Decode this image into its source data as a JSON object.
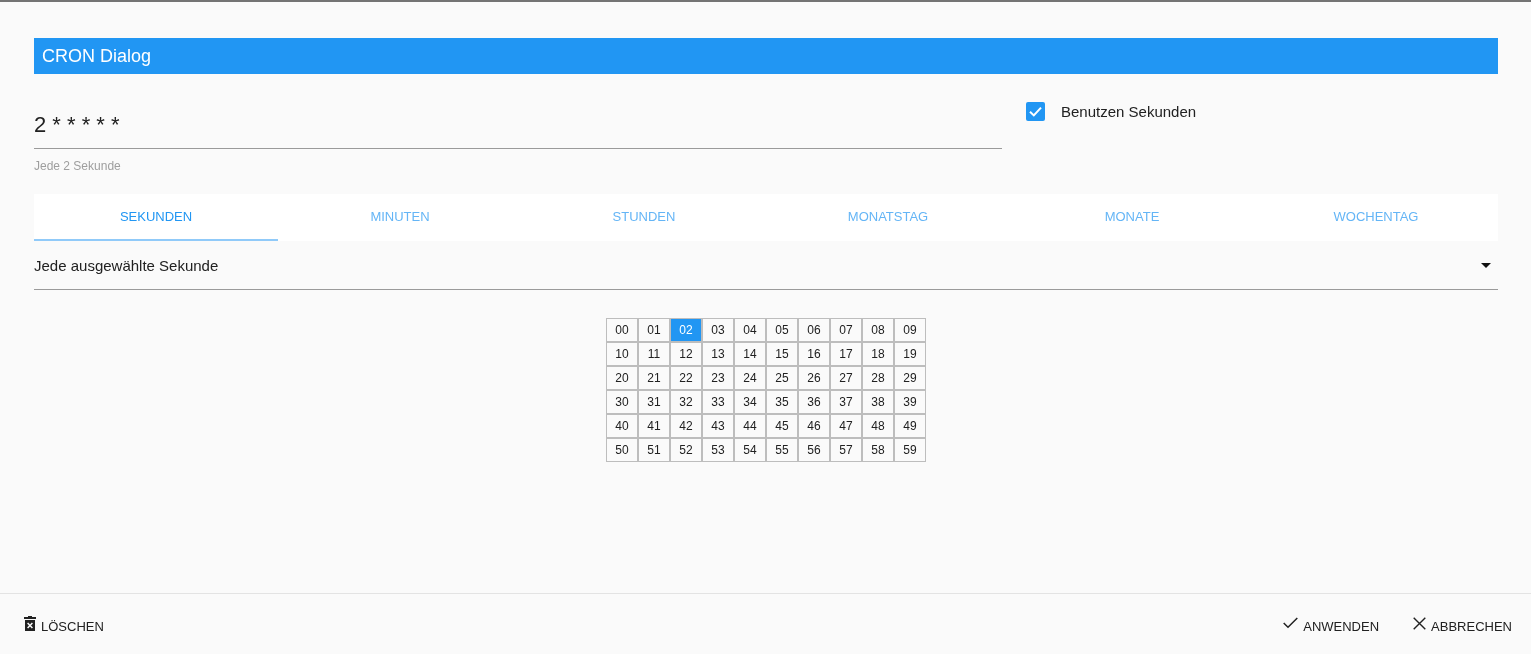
{
  "dialog": {
    "title": "CRON Dialog"
  },
  "cron_field": {
    "value": "2 * * * * *",
    "helper": "Jede 2 Sekunde"
  },
  "use_seconds": {
    "label": "Benutzen Sekunden",
    "checked": true
  },
  "tabs": [
    {
      "label": "SEKUNDEN",
      "selected": true
    },
    {
      "label": "MINUTEN",
      "selected": false
    },
    {
      "label": "STUNDEN",
      "selected": false
    },
    {
      "label": "MONATSTAG",
      "selected": false
    },
    {
      "label": "MONATE",
      "selected": false
    },
    {
      "label": "WOCHENTAG",
      "selected": false
    }
  ],
  "mode_select": {
    "value": "Jede ausgewählte Sekunde"
  },
  "seconds": [
    {
      "label": "00",
      "selected": false
    },
    {
      "label": "01",
      "selected": false
    },
    {
      "label": "02",
      "selected": true
    },
    {
      "label": "03",
      "selected": false
    },
    {
      "label": "04",
      "selected": false
    },
    {
      "label": "05",
      "selected": false
    },
    {
      "label": "06",
      "selected": false
    },
    {
      "label": "07",
      "selected": false
    },
    {
      "label": "08",
      "selected": false
    },
    {
      "label": "09",
      "selected": false
    },
    {
      "label": "10",
      "selected": false
    },
    {
      "label": "11",
      "selected": false
    },
    {
      "label": "12",
      "selected": false
    },
    {
      "label": "13",
      "selected": false
    },
    {
      "label": "14",
      "selected": false
    },
    {
      "label": "15",
      "selected": false
    },
    {
      "label": "16",
      "selected": false
    },
    {
      "label": "17",
      "selected": false
    },
    {
      "label": "18",
      "selected": false
    },
    {
      "label": "19",
      "selected": false
    },
    {
      "label": "20",
      "selected": false
    },
    {
      "label": "21",
      "selected": false
    },
    {
      "label": "22",
      "selected": false
    },
    {
      "label": "23",
      "selected": false
    },
    {
      "label": "24",
      "selected": false
    },
    {
      "label": "25",
      "selected": false
    },
    {
      "label": "26",
      "selected": false
    },
    {
      "label": "27",
      "selected": false
    },
    {
      "label": "28",
      "selected": false
    },
    {
      "label": "29",
      "selected": false
    },
    {
      "label": "30",
      "selected": false
    },
    {
      "label": "31",
      "selected": false
    },
    {
      "label": "32",
      "selected": false
    },
    {
      "label": "33",
      "selected": false
    },
    {
      "label": "34",
      "selected": false
    },
    {
      "label": "35",
      "selected": false
    },
    {
      "label": "36",
      "selected": false
    },
    {
      "label": "37",
      "selected": false
    },
    {
      "label": "38",
      "selected": false
    },
    {
      "label": "39",
      "selected": false
    },
    {
      "label": "40",
      "selected": false
    },
    {
      "label": "41",
      "selected": false
    },
    {
      "label": "42",
      "selected": false
    },
    {
      "label": "43",
      "selected": false
    },
    {
      "label": "44",
      "selected": false
    },
    {
      "label": "45",
      "selected": false
    },
    {
      "label": "46",
      "selected": false
    },
    {
      "label": "47",
      "selected": false
    },
    {
      "label": "48",
      "selected": false
    },
    {
      "label": "49",
      "selected": false
    },
    {
      "label": "50",
      "selected": false
    },
    {
      "label": "51",
      "selected": false
    },
    {
      "label": "52",
      "selected": false
    },
    {
      "label": "53",
      "selected": false
    },
    {
      "label": "54",
      "selected": false
    },
    {
      "label": "55",
      "selected": false
    },
    {
      "label": "56",
      "selected": false
    },
    {
      "label": "57",
      "selected": false
    },
    {
      "label": "58",
      "selected": false
    },
    {
      "label": "59",
      "selected": false
    }
  ],
  "footer": {
    "left_buttons": [
      {
        "kind": "delete",
        "label": "LÖSCHEN"
      }
    ],
    "right_buttons": [
      {
        "kind": "apply",
        "label": "ANWENDEN"
      },
      {
        "kind": "cancel",
        "label": "ABBRECHEN"
      }
    ]
  }
}
